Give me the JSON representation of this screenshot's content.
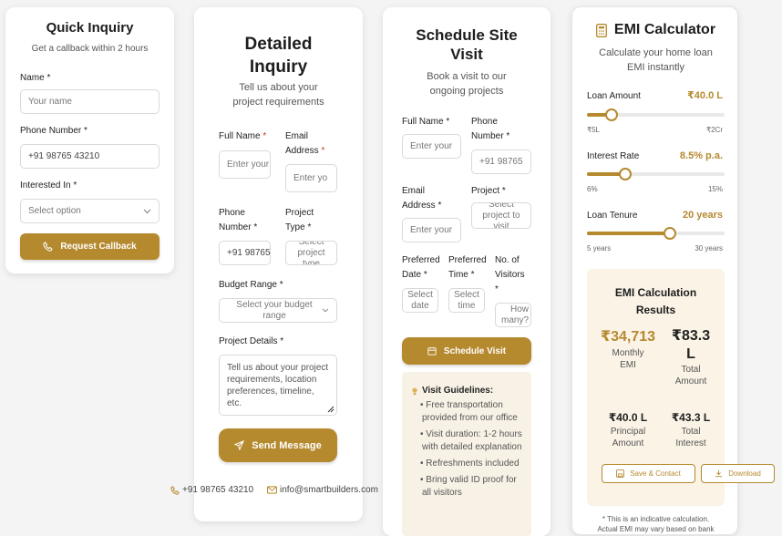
{
  "quick": {
    "title": "Quick Inquiry",
    "subtitle": "Get a callback within 2 hours",
    "name_label": "Name",
    "name_placeholder": "Your name",
    "phone_label": "Phone Number",
    "phone_placeholder": "+91 98765 43210",
    "interest_label": "Interested In",
    "interest_value": "Select option",
    "button": "Request Callback",
    "req": "*"
  },
  "detailed": {
    "title_line1": "Detailed",
    "title_line2": "Inquiry",
    "subtitle_line1": "Tell us about your",
    "subtitle_line2": "project requirements",
    "fullname_label": "Full Name",
    "fullname_placeholder": "Enter your",
    "email_label_line1": "Email",
    "email_label_line2": "Address",
    "email_placeholder": "Enter yo",
    "phone_label_line1": "Phone",
    "phone_label_line2": "Number",
    "phone_placeholder": "+91 98765",
    "ptype_label_line1": "Project",
    "ptype_label_line2": "Type",
    "ptype_value": "Select project type",
    "budget_label": "Budget Range",
    "budget_value": "Select your budget range",
    "details_label": "Project Details",
    "details_placeholder": "Tell us about your project requirements, location preferences, timeline, etc.",
    "button": "Send Message",
    "req": "*"
  },
  "contact": {
    "phone": "+91 98765 43210",
    "email": "info@smartbuilders.com"
  },
  "visit": {
    "title_line1": "Schedule Site",
    "title_line2": "Visit",
    "subtitle_line1": "Book a visit to our",
    "subtitle_line2": "ongoing projects",
    "fullname_label": "Full Name",
    "fullname_placeholder": "Enter your",
    "phone_label_line1": "Phone",
    "phone_label_line2": "Number",
    "phone_placeholder": "+91 98765",
    "email_label_line1": "Email",
    "email_label_line2": "Address",
    "email_placeholder": "Enter your",
    "project_label": "Project",
    "project_value": "Select project to visit",
    "date_label_line1": "Preferred",
    "date_label_line2": "Date",
    "date_value": "Select date",
    "time_label_line1": "Preferred",
    "time_label_line2": "Time",
    "time_value": "Select time",
    "visitors_label_line1": "No. of",
    "visitors_label_line2": "Visitors",
    "visitors_value": "How many?",
    "button": "Schedule Visit",
    "guidelines_title": "Visit Guidelines:",
    "guidelines": [
      "• Free transportation provided from our office",
      "• Visit duration: 1-2 hours with detailed explanation",
      "• Refreshments included",
      "• Bring valid ID proof for all visitors"
    ],
    "req": "*"
  },
  "emi": {
    "title": "EMI Calculator",
    "subtitle_line1": "Calculate your home loan",
    "subtitle_line2": "EMI instantly",
    "loan_label": "Loan Amount",
    "loan_value": "₹40.0 L",
    "loan_min": "₹5L",
    "loan_max": "₹2Cr",
    "loan_fraction": 0.18,
    "rate_label": "Interest Rate",
    "rate_value": "8.5% p.a.",
    "rate_min": "6%",
    "rate_max": "15%",
    "rate_fraction": 0.28,
    "tenure_label": "Loan Tenure",
    "tenure_value": "20 years",
    "tenure_min": "5 years",
    "tenure_max": "30 years",
    "tenure_fraction": 0.6,
    "results_title_line1": "EMI Calculation",
    "results_title_line2": "Results",
    "monthly_value": "₹34,713",
    "monthly_label_line1": "Monthly",
    "monthly_label_line2": "EMI",
    "total_amount_value_line1": "₹83.3",
    "total_amount_value_line2": "L",
    "total_amount_label_line1": "Total",
    "total_amount_label_line2": "Amount",
    "principal_value": "₹40.0 L",
    "principal_label_line1": "Principal",
    "principal_label_line2": "Amount",
    "interest_value": "₹43.3 L",
    "interest_label_line1": "Total",
    "interest_label_line2": "Interest",
    "save_button": "Save & Contact",
    "download_button": "Download",
    "note_line1": "* This is an indicative calculation.",
    "note_line2": "Actual EMI may vary based on bank"
  },
  "colors": {
    "accent": "#b5892e",
    "results_bg": "#faf3e6"
  }
}
